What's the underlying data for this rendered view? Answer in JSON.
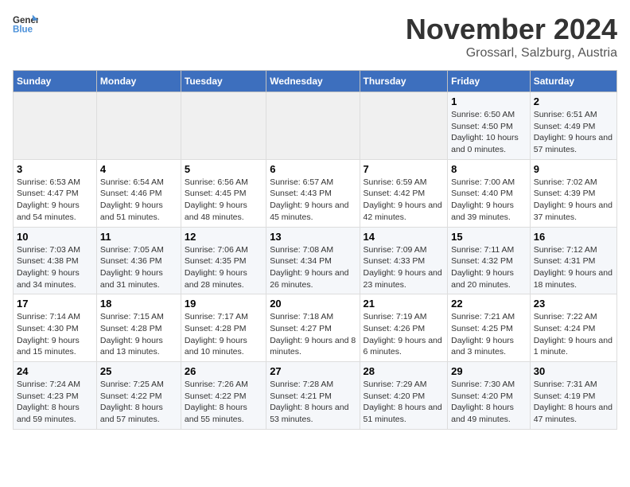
{
  "logo": {
    "line1": "General",
    "line2": "Blue"
  },
  "title": "November 2024",
  "location": "Grossarl, Salzburg, Austria",
  "weekdays": [
    "Sunday",
    "Monday",
    "Tuesday",
    "Wednesday",
    "Thursday",
    "Friday",
    "Saturday"
  ],
  "weeks": [
    [
      {
        "day": "",
        "info": ""
      },
      {
        "day": "",
        "info": ""
      },
      {
        "day": "",
        "info": ""
      },
      {
        "day": "",
        "info": ""
      },
      {
        "day": "",
        "info": ""
      },
      {
        "day": "1",
        "info": "Sunrise: 6:50 AM\nSunset: 4:50 PM\nDaylight: 10 hours and 0 minutes."
      },
      {
        "day": "2",
        "info": "Sunrise: 6:51 AM\nSunset: 4:49 PM\nDaylight: 9 hours and 57 minutes."
      }
    ],
    [
      {
        "day": "3",
        "info": "Sunrise: 6:53 AM\nSunset: 4:47 PM\nDaylight: 9 hours and 54 minutes."
      },
      {
        "day": "4",
        "info": "Sunrise: 6:54 AM\nSunset: 4:46 PM\nDaylight: 9 hours and 51 minutes."
      },
      {
        "day": "5",
        "info": "Sunrise: 6:56 AM\nSunset: 4:45 PM\nDaylight: 9 hours and 48 minutes."
      },
      {
        "day": "6",
        "info": "Sunrise: 6:57 AM\nSunset: 4:43 PM\nDaylight: 9 hours and 45 minutes."
      },
      {
        "day": "7",
        "info": "Sunrise: 6:59 AM\nSunset: 4:42 PM\nDaylight: 9 hours and 42 minutes."
      },
      {
        "day": "8",
        "info": "Sunrise: 7:00 AM\nSunset: 4:40 PM\nDaylight: 9 hours and 39 minutes."
      },
      {
        "day": "9",
        "info": "Sunrise: 7:02 AM\nSunset: 4:39 PM\nDaylight: 9 hours and 37 minutes."
      }
    ],
    [
      {
        "day": "10",
        "info": "Sunrise: 7:03 AM\nSunset: 4:38 PM\nDaylight: 9 hours and 34 minutes."
      },
      {
        "day": "11",
        "info": "Sunrise: 7:05 AM\nSunset: 4:36 PM\nDaylight: 9 hours and 31 minutes."
      },
      {
        "day": "12",
        "info": "Sunrise: 7:06 AM\nSunset: 4:35 PM\nDaylight: 9 hours and 28 minutes."
      },
      {
        "day": "13",
        "info": "Sunrise: 7:08 AM\nSunset: 4:34 PM\nDaylight: 9 hours and 26 minutes."
      },
      {
        "day": "14",
        "info": "Sunrise: 7:09 AM\nSunset: 4:33 PM\nDaylight: 9 hours and 23 minutes."
      },
      {
        "day": "15",
        "info": "Sunrise: 7:11 AM\nSunset: 4:32 PM\nDaylight: 9 hours and 20 minutes."
      },
      {
        "day": "16",
        "info": "Sunrise: 7:12 AM\nSunset: 4:31 PM\nDaylight: 9 hours and 18 minutes."
      }
    ],
    [
      {
        "day": "17",
        "info": "Sunrise: 7:14 AM\nSunset: 4:30 PM\nDaylight: 9 hours and 15 minutes."
      },
      {
        "day": "18",
        "info": "Sunrise: 7:15 AM\nSunset: 4:28 PM\nDaylight: 9 hours and 13 minutes."
      },
      {
        "day": "19",
        "info": "Sunrise: 7:17 AM\nSunset: 4:28 PM\nDaylight: 9 hours and 10 minutes."
      },
      {
        "day": "20",
        "info": "Sunrise: 7:18 AM\nSunset: 4:27 PM\nDaylight: 9 hours and 8 minutes."
      },
      {
        "day": "21",
        "info": "Sunrise: 7:19 AM\nSunset: 4:26 PM\nDaylight: 9 hours and 6 minutes."
      },
      {
        "day": "22",
        "info": "Sunrise: 7:21 AM\nSunset: 4:25 PM\nDaylight: 9 hours and 3 minutes."
      },
      {
        "day": "23",
        "info": "Sunrise: 7:22 AM\nSunset: 4:24 PM\nDaylight: 9 hours and 1 minute."
      }
    ],
    [
      {
        "day": "24",
        "info": "Sunrise: 7:24 AM\nSunset: 4:23 PM\nDaylight: 8 hours and 59 minutes."
      },
      {
        "day": "25",
        "info": "Sunrise: 7:25 AM\nSunset: 4:22 PM\nDaylight: 8 hours and 57 minutes."
      },
      {
        "day": "26",
        "info": "Sunrise: 7:26 AM\nSunset: 4:22 PM\nDaylight: 8 hours and 55 minutes."
      },
      {
        "day": "27",
        "info": "Sunrise: 7:28 AM\nSunset: 4:21 PM\nDaylight: 8 hours and 53 minutes."
      },
      {
        "day": "28",
        "info": "Sunrise: 7:29 AM\nSunset: 4:20 PM\nDaylight: 8 hours and 51 minutes."
      },
      {
        "day": "29",
        "info": "Sunrise: 7:30 AM\nSunset: 4:20 PM\nDaylight: 8 hours and 49 minutes."
      },
      {
        "day": "30",
        "info": "Sunrise: 7:31 AM\nSunset: 4:19 PM\nDaylight: 8 hours and 47 minutes."
      }
    ]
  ]
}
